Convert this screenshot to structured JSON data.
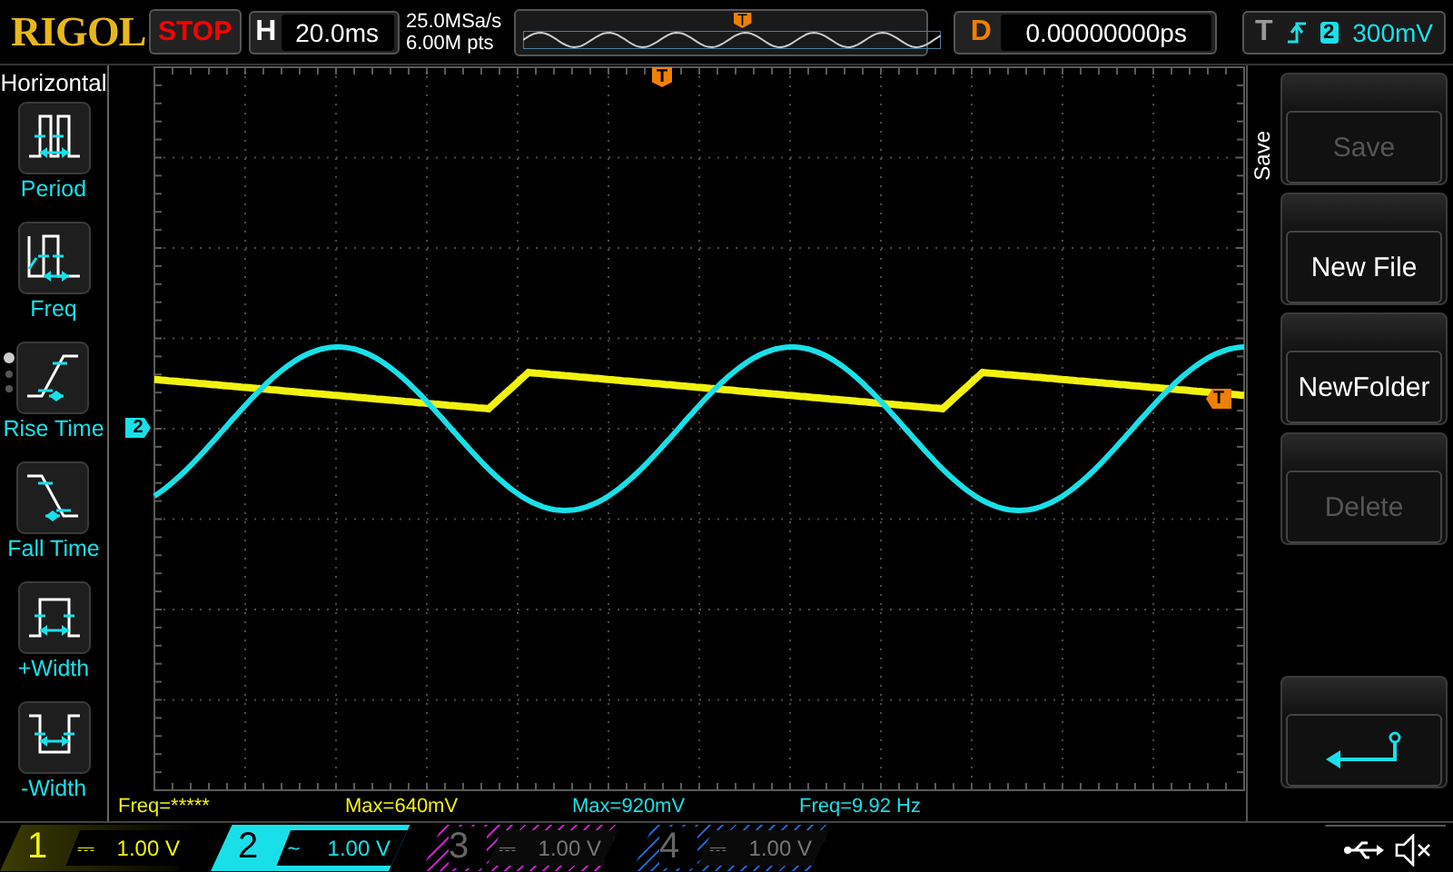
{
  "top_bar": {
    "logo": "RIGOL",
    "run_state": "STOP",
    "timebase": {
      "label": "H",
      "value": "20.0ms"
    },
    "sample_rate": "25.0MSa/s",
    "memory_depth": "6.00M pts",
    "overview_marker": "T",
    "delay": {
      "label": "D",
      "value": "0.00000000ps"
    },
    "trigger": {
      "label": "T",
      "kind": "rising",
      "source": "2",
      "level": "300mV"
    }
  },
  "side_menu": {
    "title": "Horizontal",
    "items": [
      {
        "label": "Period",
        "kind": "period"
      },
      {
        "label": "Freq",
        "kind": "freq"
      },
      {
        "label": "Rise Time",
        "kind": "rise"
      },
      {
        "label": "Fall Time",
        "kind": "fall"
      },
      {
        "label": "+Width",
        "kind": "pwidth"
      },
      {
        "label": "-Width",
        "kind": "nwidth"
      }
    ],
    "pages": [
      {
        "selected": true
      },
      {
        "selected": false
      },
      {
        "selected": false
      }
    ]
  },
  "grid_markers": {
    "trigger_position": "T",
    "channel": "2",
    "trigger_level": "T"
  },
  "measurements": [
    {
      "text": "Freq=*****",
      "color": "#f2f20f"
    },
    {
      "text": "Max=640mV",
      "color": "#f2f20f"
    },
    {
      "text": "Max=920mV",
      "color": "#19e0e8"
    },
    {
      "text": "Freq=9.92 Hz",
      "color": "#19e0e8"
    }
  ],
  "soft_menu": {
    "title": "Save",
    "buttons": [
      {
        "label": "Save",
        "disabled": true
      },
      {
        "label": "New File",
        "disabled": false
      },
      {
        "label": "NewFolder",
        "disabled": false
      },
      {
        "label": "Delete",
        "disabled": true
      }
    ]
  },
  "channels": [
    {
      "number": "1",
      "coupling": "⎓",
      "scale": "1.00 V",
      "color": "#f2f20f",
      "selected": false,
      "enabled": true
    },
    {
      "number": "2",
      "coupling": "~",
      "scale": "1.00 V",
      "color": "#19e0e8",
      "selected": true,
      "enabled": true
    },
    {
      "number": "3",
      "coupling": "⎓",
      "scale": "1.00 V",
      "color": "#c020c0",
      "selected": false,
      "enabled": false
    },
    {
      "number": "4",
      "coupling": "⎓",
      "scale": "1.00 V",
      "color": "#2060c0",
      "selected": false,
      "enabled": false
    }
  ]
}
